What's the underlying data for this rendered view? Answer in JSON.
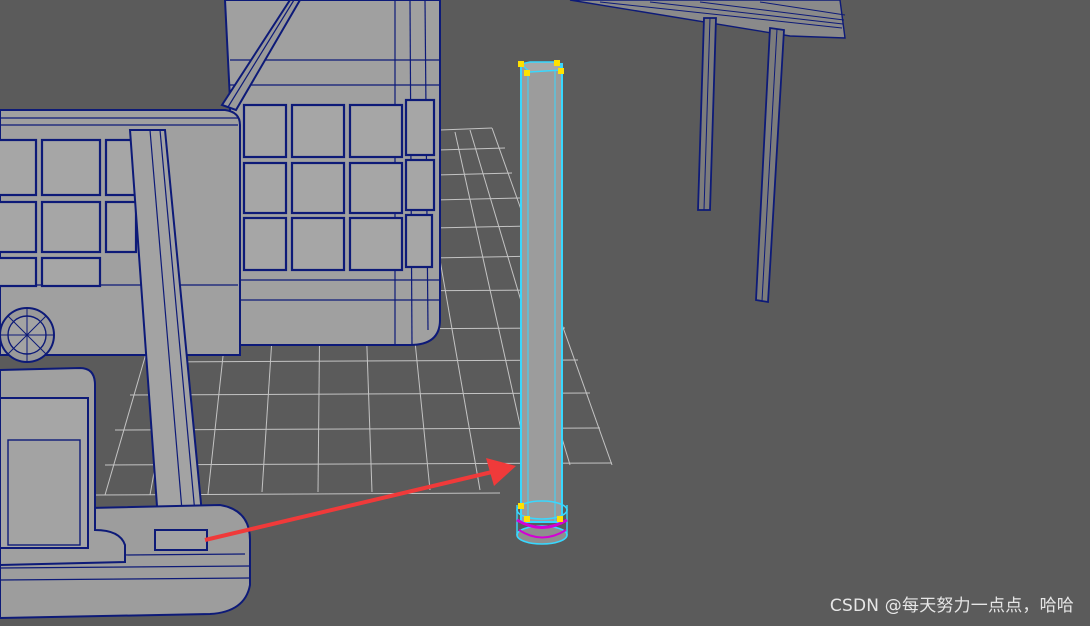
{
  "viewport": {
    "background_color": "#5b5b5b",
    "grid_color": "#c8c8c8",
    "mesh_fill_color": "#a3a3a3",
    "wireframe_color": "#0d1a78",
    "selection_color": "#38d8ff",
    "vertex_color": "#ffe100",
    "pivot_color": "#d400d4",
    "arrow_color": "#f03a3a"
  },
  "watermark": {
    "text": "CSDN @每天努力一点点，哈哈"
  }
}
